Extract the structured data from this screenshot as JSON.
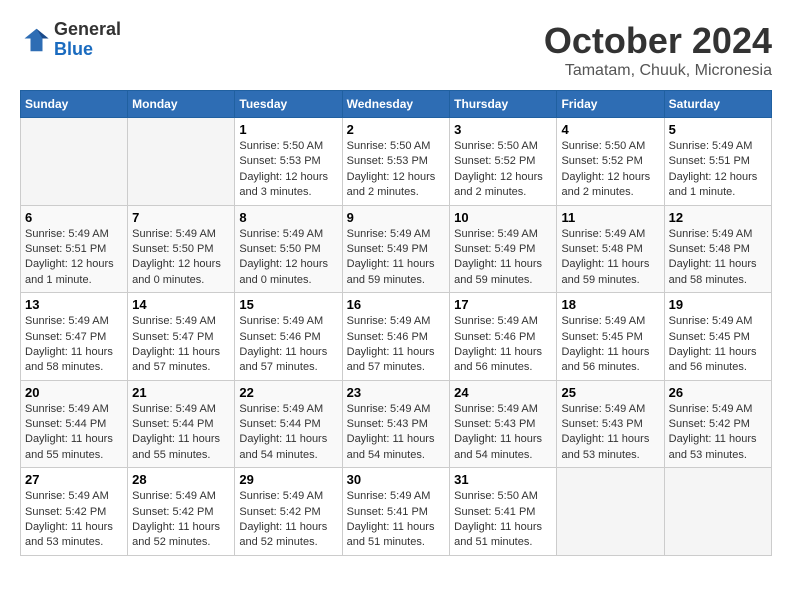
{
  "header": {
    "logo_line1": "General",
    "logo_line2": "Blue",
    "title": "October 2024",
    "subtitle": "Tamatam, Chuuk, Micronesia"
  },
  "weekdays": [
    "Sunday",
    "Monday",
    "Tuesday",
    "Wednesday",
    "Thursday",
    "Friday",
    "Saturday"
  ],
  "weeks": [
    [
      {
        "day": "",
        "info": ""
      },
      {
        "day": "",
        "info": ""
      },
      {
        "day": "1",
        "info": "Sunrise: 5:50 AM\nSunset: 5:53 PM\nDaylight: 12 hours and 3 minutes."
      },
      {
        "day": "2",
        "info": "Sunrise: 5:50 AM\nSunset: 5:53 PM\nDaylight: 12 hours and 2 minutes."
      },
      {
        "day": "3",
        "info": "Sunrise: 5:50 AM\nSunset: 5:52 PM\nDaylight: 12 hours and 2 minutes."
      },
      {
        "day": "4",
        "info": "Sunrise: 5:50 AM\nSunset: 5:52 PM\nDaylight: 12 hours and 2 minutes."
      },
      {
        "day": "5",
        "info": "Sunrise: 5:49 AM\nSunset: 5:51 PM\nDaylight: 12 hours and 1 minute."
      }
    ],
    [
      {
        "day": "6",
        "info": "Sunrise: 5:49 AM\nSunset: 5:51 PM\nDaylight: 12 hours and 1 minute."
      },
      {
        "day": "7",
        "info": "Sunrise: 5:49 AM\nSunset: 5:50 PM\nDaylight: 12 hours and 0 minutes."
      },
      {
        "day": "8",
        "info": "Sunrise: 5:49 AM\nSunset: 5:50 PM\nDaylight: 12 hours and 0 minutes."
      },
      {
        "day": "9",
        "info": "Sunrise: 5:49 AM\nSunset: 5:49 PM\nDaylight: 11 hours and 59 minutes."
      },
      {
        "day": "10",
        "info": "Sunrise: 5:49 AM\nSunset: 5:49 PM\nDaylight: 11 hours and 59 minutes."
      },
      {
        "day": "11",
        "info": "Sunrise: 5:49 AM\nSunset: 5:48 PM\nDaylight: 11 hours and 59 minutes."
      },
      {
        "day": "12",
        "info": "Sunrise: 5:49 AM\nSunset: 5:48 PM\nDaylight: 11 hours and 58 minutes."
      }
    ],
    [
      {
        "day": "13",
        "info": "Sunrise: 5:49 AM\nSunset: 5:47 PM\nDaylight: 11 hours and 58 minutes."
      },
      {
        "day": "14",
        "info": "Sunrise: 5:49 AM\nSunset: 5:47 PM\nDaylight: 11 hours and 57 minutes."
      },
      {
        "day": "15",
        "info": "Sunrise: 5:49 AM\nSunset: 5:46 PM\nDaylight: 11 hours and 57 minutes."
      },
      {
        "day": "16",
        "info": "Sunrise: 5:49 AM\nSunset: 5:46 PM\nDaylight: 11 hours and 57 minutes."
      },
      {
        "day": "17",
        "info": "Sunrise: 5:49 AM\nSunset: 5:46 PM\nDaylight: 11 hours and 56 minutes."
      },
      {
        "day": "18",
        "info": "Sunrise: 5:49 AM\nSunset: 5:45 PM\nDaylight: 11 hours and 56 minutes."
      },
      {
        "day": "19",
        "info": "Sunrise: 5:49 AM\nSunset: 5:45 PM\nDaylight: 11 hours and 56 minutes."
      }
    ],
    [
      {
        "day": "20",
        "info": "Sunrise: 5:49 AM\nSunset: 5:44 PM\nDaylight: 11 hours and 55 minutes."
      },
      {
        "day": "21",
        "info": "Sunrise: 5:49 AM\nSunset: 5:44 PM\nDaylight: 11 hours and 55 minutes."
      },
      {
        "day": "22",
        "info": "Sunrise: 5:49 AM\nSunset: 5:44 PM\nDaylight: 11 hours and 54 minutes."
      },
      {
        "day": "23",
        "info": "Sunrise: 5:49 AM\nSunset: 5:43 PM\nDaylight: 11 hours and 54 minutes."
      },
      {
        "day": "24",
        "info": "Sunrise: 5:49 AM\nSunset: 5:43 PM\nDaylight: 11 hours and 54 minutes."
      },
      {
        "day": "25",
        "info": "Sunrise: 5:49 AM\nSunset: 5:43 PM\nDaylight: 11 hours and 53 minutes."
      },
      {
        "day": "26",
        "info": "Sunrise: 5:49 AM\nSunset: 5:42 PM\nDaylight: 11 hours and 53 minutes."
      }
    ],
    [
      {
        "day": "27",
        "info": "Sunrise: 5:49 AM\nSunset: 5:42 PM\nDaylight: 11 hours and 53 minutes."
      },
      {
        "day": "28",
        "info": "Sunrise: 5:49 AM\nSunset: 5:42 PM\nDaylight: 11 hours and 52 minutes."
      },
      {
        "day": "29",
        "info": "Sunrise: 5:49 AM\nSunset: 5:42 PM\nDaylight: 11 hours and 52 minutes."
      },
      {
        "day": "30",
        "info": "Sunrise: 5:49 AM\nSunset: 5:41 PM\nDaylight: 11 hours and 51 minutes."
      },
      {
        "day": "31",
        "info": "Sunrise: 5:50 AM\nSunset: 5:41 PM\nDaylight: 11 hours and 51 minutes."
      },
      {
        "day": "",
        "info": ""
      },
      {
        "day": "",
        "info": ""
      }
    ]
  ]
}
